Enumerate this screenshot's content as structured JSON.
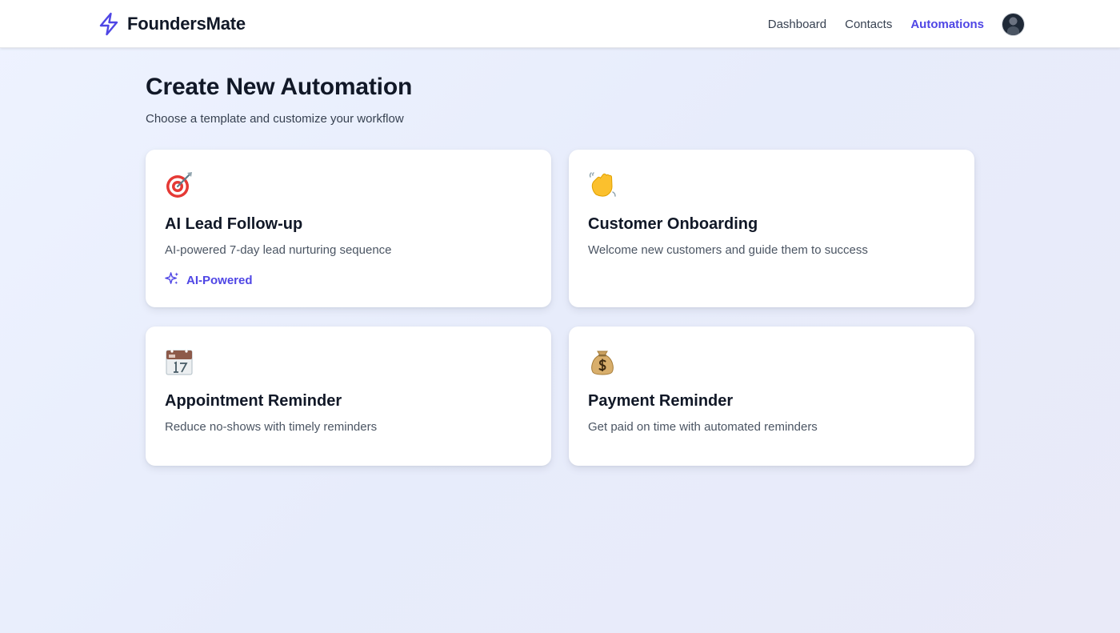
{
  "app": {
    "brand": "FoundersMate",
    "brand_icon": "lightning-bolt-icon",
    "accent_color": "#4f46e5"
  },
  "nav": {
    "items": [
      {
        "label": "Dashboard",
        "active": false
      },
      {
        "label": "Contacts",
        "active": false
      },
      {
        "label": "Automations",
        "active": true
      }
    ],
    "avatar": "user-avatar"
  },
  "header": {
    "title": "Create New Automation",
    "subtitle": "Choose a template and customize your workflow"
  },
  "templates": [
    {
      "icon": "target-icon",
      "title": "AI Lead Follow-up",
      "description": "AI-powered 7-day lead nurturing sequence",
      "badge": "AI-Powered",
      "badge_icon": "sparkle-icon"
    },
    {
      "icon": "waving-hand-icon",
      "title": "Customer Onboarding",
      "description": "Welcome new customers and guide them to success"
    },
    {
      "icon": "calendar-icon",
      "title": "Appointment Reminder",
      "description": "Reduce no-shows with timely reminders"
    },
    {
      "icon": "money-bag-icon",
      "title": "Payment Reminder",
      "description": "Get paid on time with automated reminders"
    }
  ]
}
